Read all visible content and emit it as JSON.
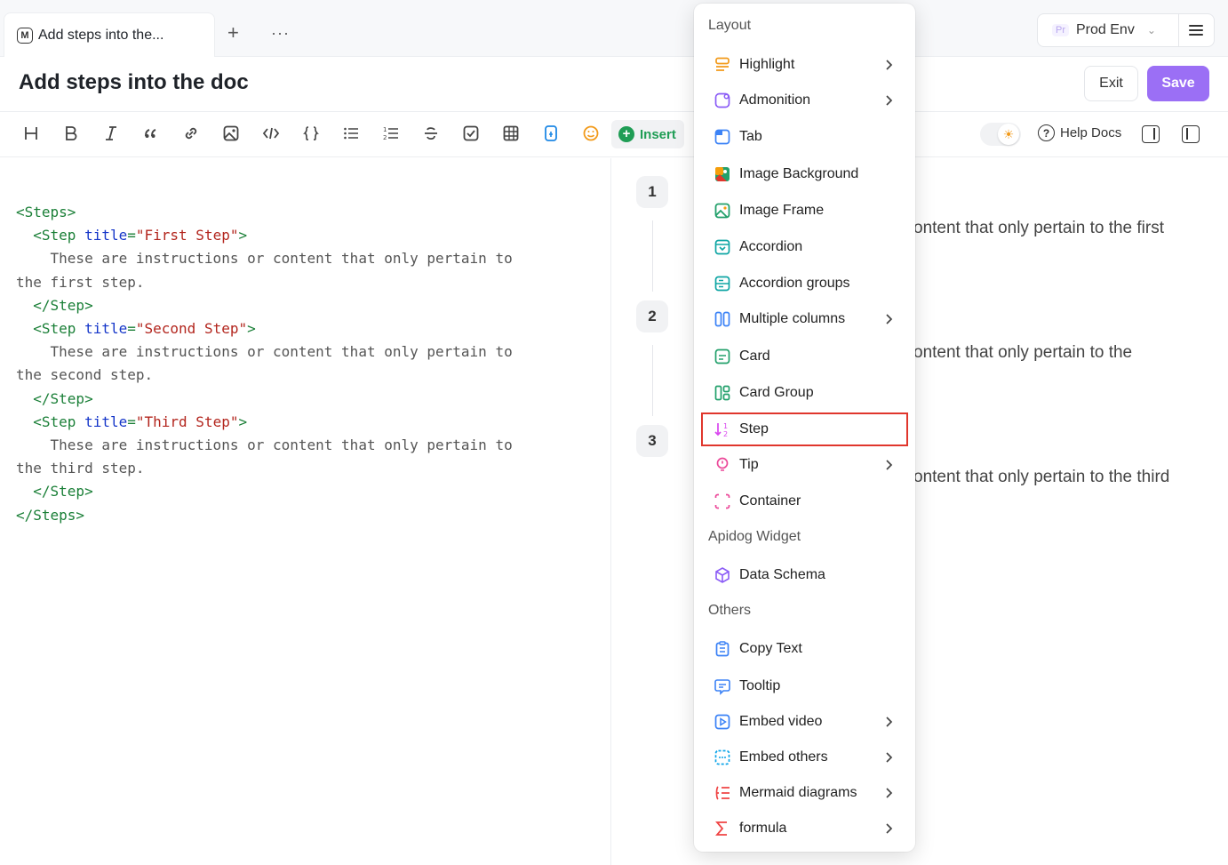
{
  "tabbar": {
    "active_tab_label": "Add steps into the...",
    "active_tab_icon": "markdown-file-icon",
    "new_tab_symbol": "+",
    "more_symbol": "···"
  },
  "environment": {
    "badge": "Pr",
    "label": "Prod Env"
  },
  "header": {
    "title": "Add steps into the doc",
    "exit_label": "Exit",
    "save_label": "Save"
  },
  "toolbar": {
    "insert_label": "Insert",
    "help_label": "Help Docs",
    "accent_color": "#1f9d55"
  },
  "editor": {
    "lines": [
      "<Steps>",
      "  <Step title=\"First Step\">",
      "    These are instructions or content that only pertain to",
      "the first step.",
      "  </Step>",
      "  <Step title=\"Second Step\">",
      "    These are instructions or content that only pertain to",
      "the second step.",
      "  </Step>",
      "  <Step title=\"Third Step\">",
      "    These are instructions or content that only pertain to",
      "the third step.",
      "  </Step>",
      "</Steps>"
    ]
  },
  "preview": {
    "steps": [
      {
        "number": "1",
        "text": "ontent that only pertain to the first"
      },
      {
        "number": "2",
        "text": "ontent that only pertain to the"
      },
      {
        "number": "3",
        "text": "ontent that only pertain to the third"
      }
    ]
  },
  "menu": {
    "sections": [
      {
        "title": "Layout"
      },
      {
        "title": "Apidog Widget"
      },
      {
        "title": "Others"
      }
    ],
    "items": [
      {
        "label": "Highlight",
        "icon": "highlight-icon",
        "submenu": true
      },
      {
        "label": "Admonition",
        "icon": "admonition-icon",
        "submenu": true
      },
      {
        "label": "Tab",
        "icon": "tab-icon",
        "submenu": false
      },
      {
        "label": "Image Background",
        "icon": "image-background-icon",
        "submenu": false
      },
      {
        "label": "Image Frame",
        "icon": "image-frame-icon",
        "submenu": false
      },
      {
        "label": "Accordion",
        "icon": "accordion-icon",
        "submenu": false
      },
      {
        "label": "Accordion groups",
        "icon": "accordion-groups-icon",
        "submenu": false
      },
      {
        "label": "Multiple columns",
        "icon": "multiple-columns-icon",
        "submenu": true
      },
      {
        "label": "Card",
        "icon": "card-icon",
        "submenu": false
      },
      {
        "label": "Card Group",
        "icon": "card-group-icon",
        "submenu": false
      },
      {
        "label": "Step",
        "icon": "step-icon",
        "submenu": false,
        "highlighted": true
      },
      {
        "label": "Tip",
        "icon": "tip-icon",
        "submenu": true
      },
      {
        "label": "Container",
        "icon": "container-icon",
        "submenu": false
      },
      {
        "label": "Data Schema",
        "icon": "data-schema-icon",
        "submenu": false
      },
      {
        "label": "Copy Text",
        "icon": "copy-text-icon",
        "submenu": false
      },
      {
        "label": "Tooltip",
        "icon": "tooltip-icon",
        "submenu": false
      },
      {
        "label": "Embed video",
        "icon": "embed-video-icon",
        "submenu": true
      },
      {
        "label": "Embed others",
        "icon": "embed-others-icon",
        "submenu": true
      },
      {
        "label": "Mermaid diagrams",
        "icon": "mermaid-diagrams-icon",
        "submenu": true
      },
      {
        "label": "formula",
        "icon": "formula-icon",
        "submenu": true
      }
    ],
    "highlight_color": "#e0362c"
  },
  "colors": {
    "primary": "#9b6ff5",
    "tag": "#1a7f37",
    "attr": "#1536c9",
    "string": "#b3261e"
  }
}
